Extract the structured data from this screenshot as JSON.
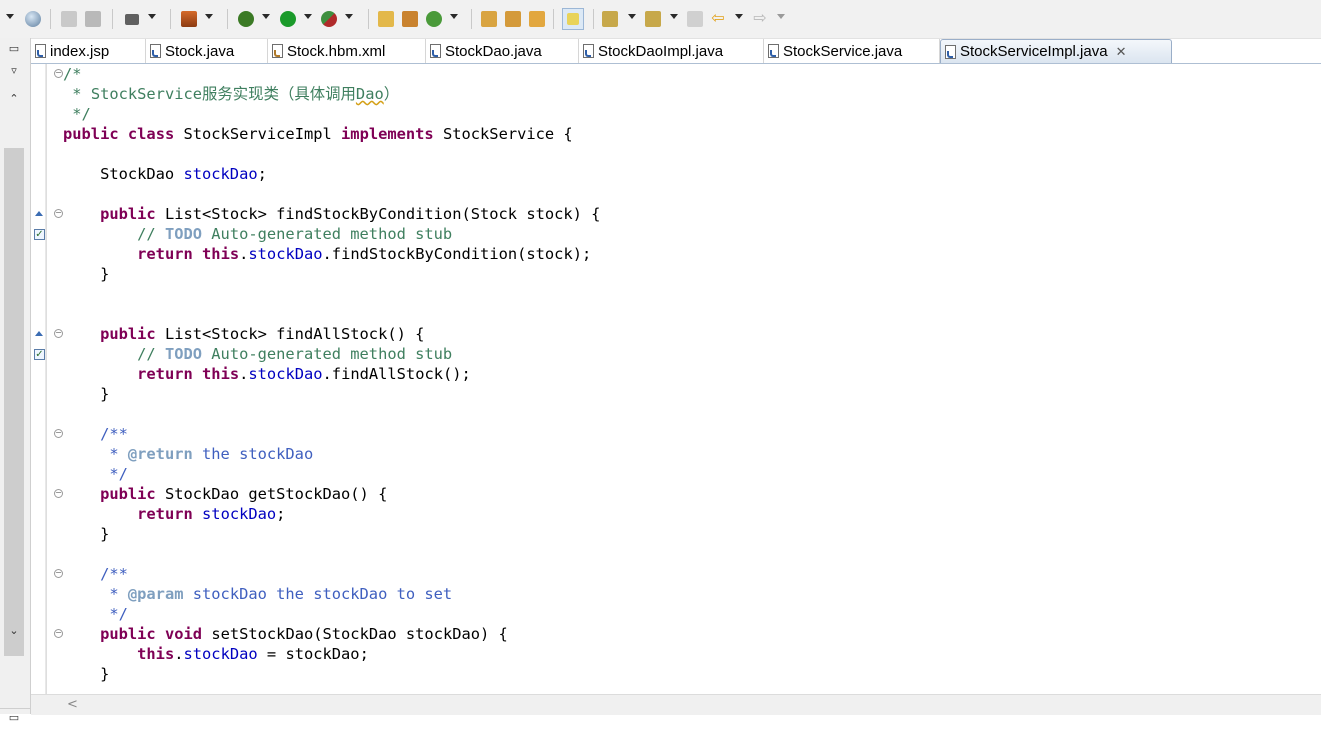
{
  "toolbar": {
    "icons": [
      "globe-icon",
      "open-folder-icon",
      "save-icon",
      "screenshot-icon",
      "new-server-icon",
      "debug-icon",
      "run-icon",
      "external-tools-icon",
      "open-type-icon",
      "new-package-icon",
      "refresh-icon",
      "open-task-icon",
      "pin-icon",
      "open-folder-icon",
      "mark-occurrences-icon",
      "next-annotation-icon",
      "prev-annotation-icon",
      "last-edit-icon",
      "back-icon",
      "forward-icon"
    ],
    "colors": {
      "run": "#1a9a2a",
      "debug": "#3b7a25",
      "highlight": "#e8d35a"
    }
  },
  "tabs": [
    {
      "label": "index.jsp"
    },
    {
      "label": "Stock.java"
    },
    {
      "label": "Stock.hbm.xml"
    },
    {
      "label": "StockDao.java"
    },
    {
      "label": "StockDaoImpl.java"
    },
    {
      "label": "StockService.java"
    },
    {
      "label": "StockServiceImpl.java",
      "active": true,
      "close": "✕"
    }
  ],
  "code": {
    "l1": "/*",
    "l2a": " * ",
    "l2b": "StockService服务实现类（具体调用",
    "l2c": "Dao",
    "l2d": "）",
    "l3": " */",
    "class_kw1": "public",
    "class_kw2": "class",
    "class_name": " StockServiceImpl ",
    "class_kw3": "implements",
    "class_rest": " StockService {",
    "field_type": "    StockDao ",
    "field_name": "stockDao",
    "field_semi": ";",
    "m1_kw": "public",
    "m1_sig": " List<Stock> findStockByCondition(Stock stock) {",
    "m1_c1": "        // ",
    "m1_todo": "TODO",
    "m1_c2": " Auto-generated method stub",
    "m1_ret": "return",
    "m1_this": "this",
    "m1_field": "stockDao",
    "m1_call": ".findStockByCondition(stock);",
    "close": "    }",
    "m2_kw": "public",
    "m2_sig": " List<Stock> findAllStock() {",
    "m2_c1": "        // ",
    "m2_todo": "TODO",
    "m2_c2": " Auto-generated method stub",
    "m2_ret": "return",
    "m2_this": "this",
    "m2_field": "stockDao",
    "m2_call": ".findAllStock();",
    "jd_open": "    /**",
    "jd1_star": "     * ",
    "jd1_tag": "@return",
    "jd1_text": " the stockDao",
    "jd_close": "     */",
    "m3_kw": "public",
    "m3_sig": " StockDao getStockDao() {",
    "m3_ret": "return",
    "m3_field": "stockDao",
    "m3_semi": ";",
    "jd2_star": "     * ",
    "jd2_tag": "@param",
    "jd2_text": " stockDao the stockDao to set",
    "m4_kw1": "public",
    "m4_kw2": "void",
    "m4_sig": " setStockDao(StockDao stockDao) {",
    "m4_this": "this",
    "m4_field": "stockDao",
    "m4_rest": " = stockDao;"
  }
}
